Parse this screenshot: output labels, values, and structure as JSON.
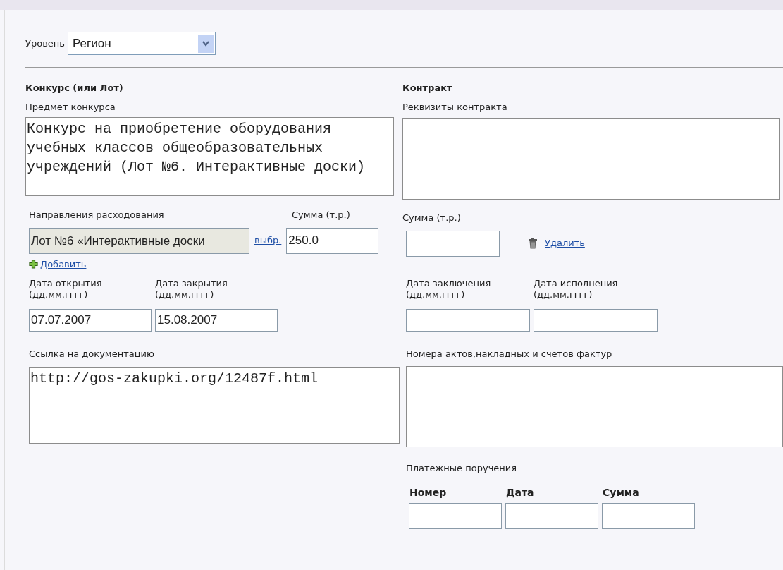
{
  "level": {
    "label": "Уровень",
    "value": "Регион"
  },
  "tender": {
    "heading": "Конкурс (или Лот)",
    "subject_label": "Предмет конкурса",
    "subject": "Конкурс на приобретение оборудования учебных классов общеобразовательных учреждений (Лот №6. Интерактивные доски)",
    "direction_label": "Направления расходования",
    "sum_label": "Сумма (т.р.)",
    "direction": "Лот №6 «Интерактивные доски",
    "choose_link": "выбр.",
    "sum": "250.0",
    "add_link": "Добавить",
    "open_date_label": "Дата открытия",
    "open_date_hint": "(дд.мм.гггг)",
    "open_date": "07.07.2007",
    "close_date_label": "Дата закрытия",
    "close_date_hint": "(дд.мм.гггг)",
    "close_date": "15.08.2007",
    "docs_label": "Ссылка на документацию",
    "docs": "http://gos-zakupki.org/12487f.html"
  },
  "contract": {
    "heading": "Контракт",
    "details_label": "Реквизиты контракта",
    "sum_label": "Сумма (т.р.)",
    "delete_link": "Удалить",
    "sign_date_label": "Дата заключения",
    "sign_date_hint": "(дд.мм.гггг)",
    "exec_date_label": "Дата исполнения",
    "exec_date_hint": "(дд.мм.гггг)",
    "acts_label": "Номера актов,накладных и счетов фактур",
    "payments_label": "Платежные поручения",
    "payment_columns": [
      "Номер",
      "Дата",
      "Сумма"
    ]
  }
}
